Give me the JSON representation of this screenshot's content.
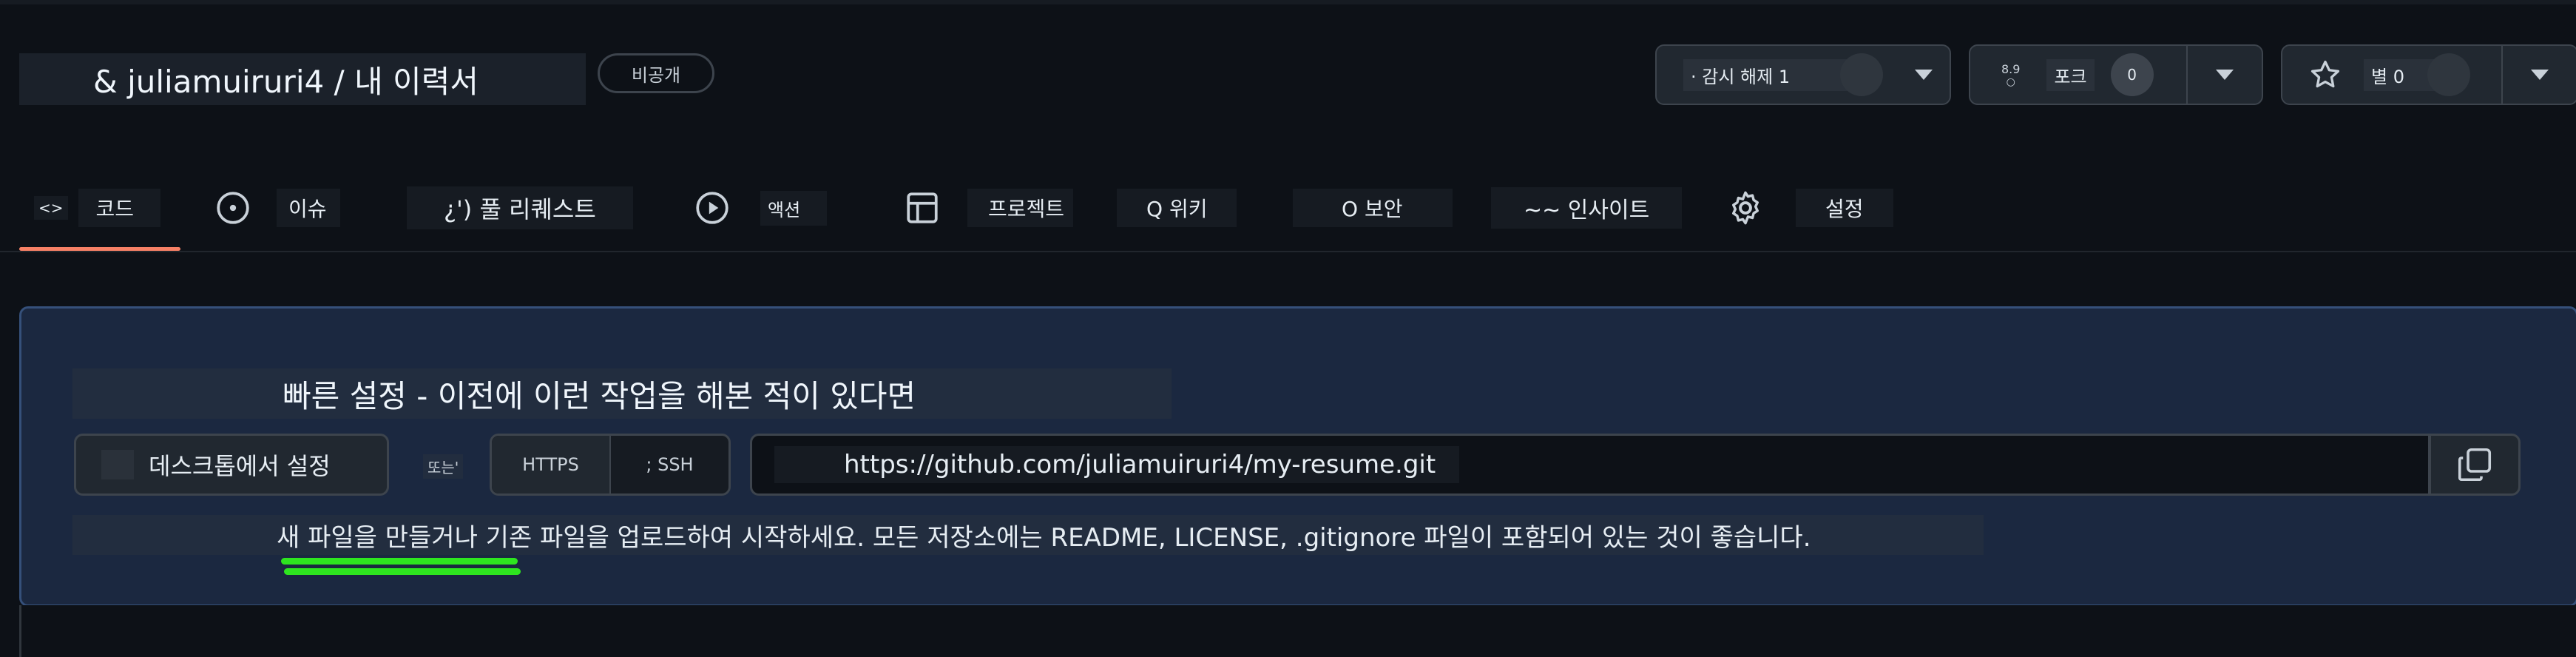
{
  "repo": {
    "title": "& juliamuiruri4 / 내 이력서",
    "visibility": "비공개"
  },
  "actions": {
    "watch": {
      "label": "· 감시 해제 1"
    },
    "fork": {
      "badge": "8.9",
      "label": "포크",
      "count": "0"
    },
    "star": {
      "label": "별 0"
    }
  },
  "nav": {
    "tabs": [
      {
        "icon": "<>",
        "label": "코드"
      },
      {
        "label": "이슈"
      },
      {
        "label": "¿') 풀 리퀘스트"
      },
      {
        "label": "액션"
      },
      {
        "label": "프로젝트"
      },
      {
        "label": "Q 위키"
      },
      {
        "label": "O 보안"
      },
      {
        "label": "~~ 인사이트"
      },
      {
        "label": "설정"
      }
    ]
  },
  "quick_setup": {
    "title": "빠른 설정 - 이전에 이런 작업을 해본 적이 있다면",
    "desktop_button": "데스크톱에서 설정",
    "or_label": "또는'",
    "protocols": [
      "HTTPS",
      "; SSH"
    ],
    "url": "https://github.com/juliamuiruri4/my-resume.git",
    "hint": "새 파일을 만들거나 기존 파일을 업로드하여 시작하세요. 모든 저장소에는 README, LICENSE, .gitignore 파일이 포함되어 있는 것이 좋습니다."
  },
  "colors": {
    "background": "#0d1117",
    "accent_underline": "#f78166",
    "panel_bg": "#1b2840",
    "highlight": "#2ee51f"
  }
}
